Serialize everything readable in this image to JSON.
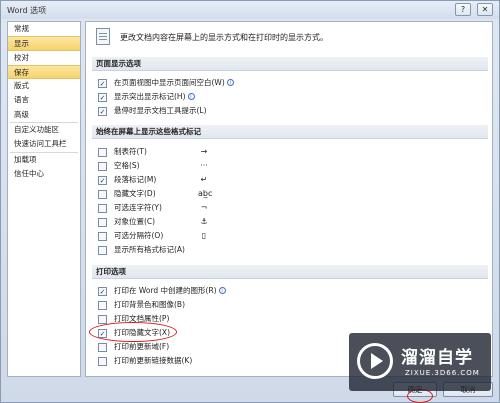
{
  "window": {
    "title": "Word 选项",
    "help_label": "?",
    "close_label": "✕"
  },
  "sidebar": {
    "items": [
      {
        "label": "常规"
      },
      {
        "label": "显示"
      },
      {
        "label": "校对"
      },
      {
        "label": "保存"
      },
      {
        "label": "版式"
      },
      {
        "label": "语言"
      },
      {
        "label": "高级"
      },
      {
        "label": "自定义功能区"
      },
      {
        "label": "快速访问工具栏"
      },
      {
        "label": "加载项"
      },
      {
        "label": "信任中心"
      }
    ],
    "active_items": [
      "显示",
      "保存"
    ]
  },
  "header": {
    "text": "更改文档内容在屏幕上的显示方式和在打印时的显示方式。",
    "icon": "document-icon"
  },
  "sections": {
    "page_display": {
      "title": "页面显示选项",
      "options": [
        {
          "label": "在页面视图中显示页面间空白(W)",
          "checked": true,
          "info": true
        },
        {
          "label": "显示突出显示标记(H)",
          "checked": true,
          "info": true
        },
        {
          "label": "悬停时显示文档工具提示(L)",
          "checked": true,
          "info": false
        }
      ]
    },
    "formatting_marks": {
      "title": "始终在屏幕上显示这些格式标记",
      "options": [
        {
          "label": "制表符(T)",
          "checked": false,
          "symbol": "→"
        },
        {
          "label": "空格(S)",
          "checked": false,
          "symbol": "···"
        },
        {
          "label": "段落标记(M)",
          "checked": true,
          "symbol": "↵"
        },
        {
          "label": "隐藏文字(D)",
          "checked": false,
          "symbol": "ab̲c"
        },
        {
          "label": "可选连字符(Y)",
          "checked": false,
          "symbol": "¬"
        },
        {
          "label": "对象位置(C)",
          "checked": false,
          "symbol": "⚓"
        },
        {
          "label": "可选分隔符(O)",
          "checked": false,
          "symbol": "▯"
        },
        {
          "label": "显示所有格式标记(A)",
          "checked": false,
          "symbol": ""
        }
      ]
    },
    "print": {
      "title": "打印选项",
      "options": [
        {
          "label": "打印在 Word 中创建的图形(R)",
          "checked": true,
          "info": true
        },
        {
          "label": "打印背景色和图像(B)",
          "checked": false,
          "info": false
        },
        {
          "label": "打印文档属性(P)",
          "checked": false,
          "info": false
        },
        {
          "label": "打印隐藏文字(X)",
          "checked": true,
          "info": false
        },
        {
          "label": "打印前更新域(F)",
          "checked": false,
          "info": false
        },
        {
          "label": "打印前更新链接数据(K)",
          "checked": false,
          "info": false
        }
      ]
    }
  },
  "buttons": {
    "ok_label": "确定",
    "cancel_label": "取消"
  },
  "watermark": {
    "name": "溜溜自学",
    "url": "ZIXUE.3D66.COM"
  },
  "colors": {
    "active_item": "#f6d36a",
    "highlight": "#d41c1c",
    "check": "#213a6b"
  }
}
